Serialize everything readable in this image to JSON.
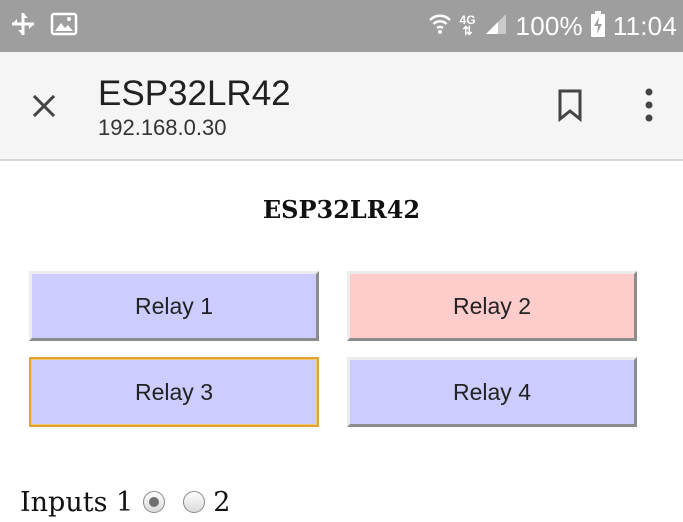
{
  "status_bar": {
    "network_type": "4G",
    "battery_percent": "100%",
    "time": "11:04"
  },
  "toolbar": {
    "title": "ESP32LR42",
    "url": "192.168.0.30"
  },
  "page": {
    "heading": "ESP32LR42",
    "relays": [
      {
        "label": "Relay 1",
        "state_color": "#ccccff"
      },
      {
        "label": "Relay 2",
        "state_color": "#ffcccc"
      },
      {
        "label": "Relay 3",
        "state_color": "#ccccff"
      },
      {
        "label": "Relay 4",
        "state_color": "#ccccff"
      }
    ],
    "inputs": {
      "label": "Inputs",
      "items": [
        {
          "label": "1",
          "checked": true
        },
        {
          "label": "2",
          "checked": false
        }
      ]
    }
  }
}
